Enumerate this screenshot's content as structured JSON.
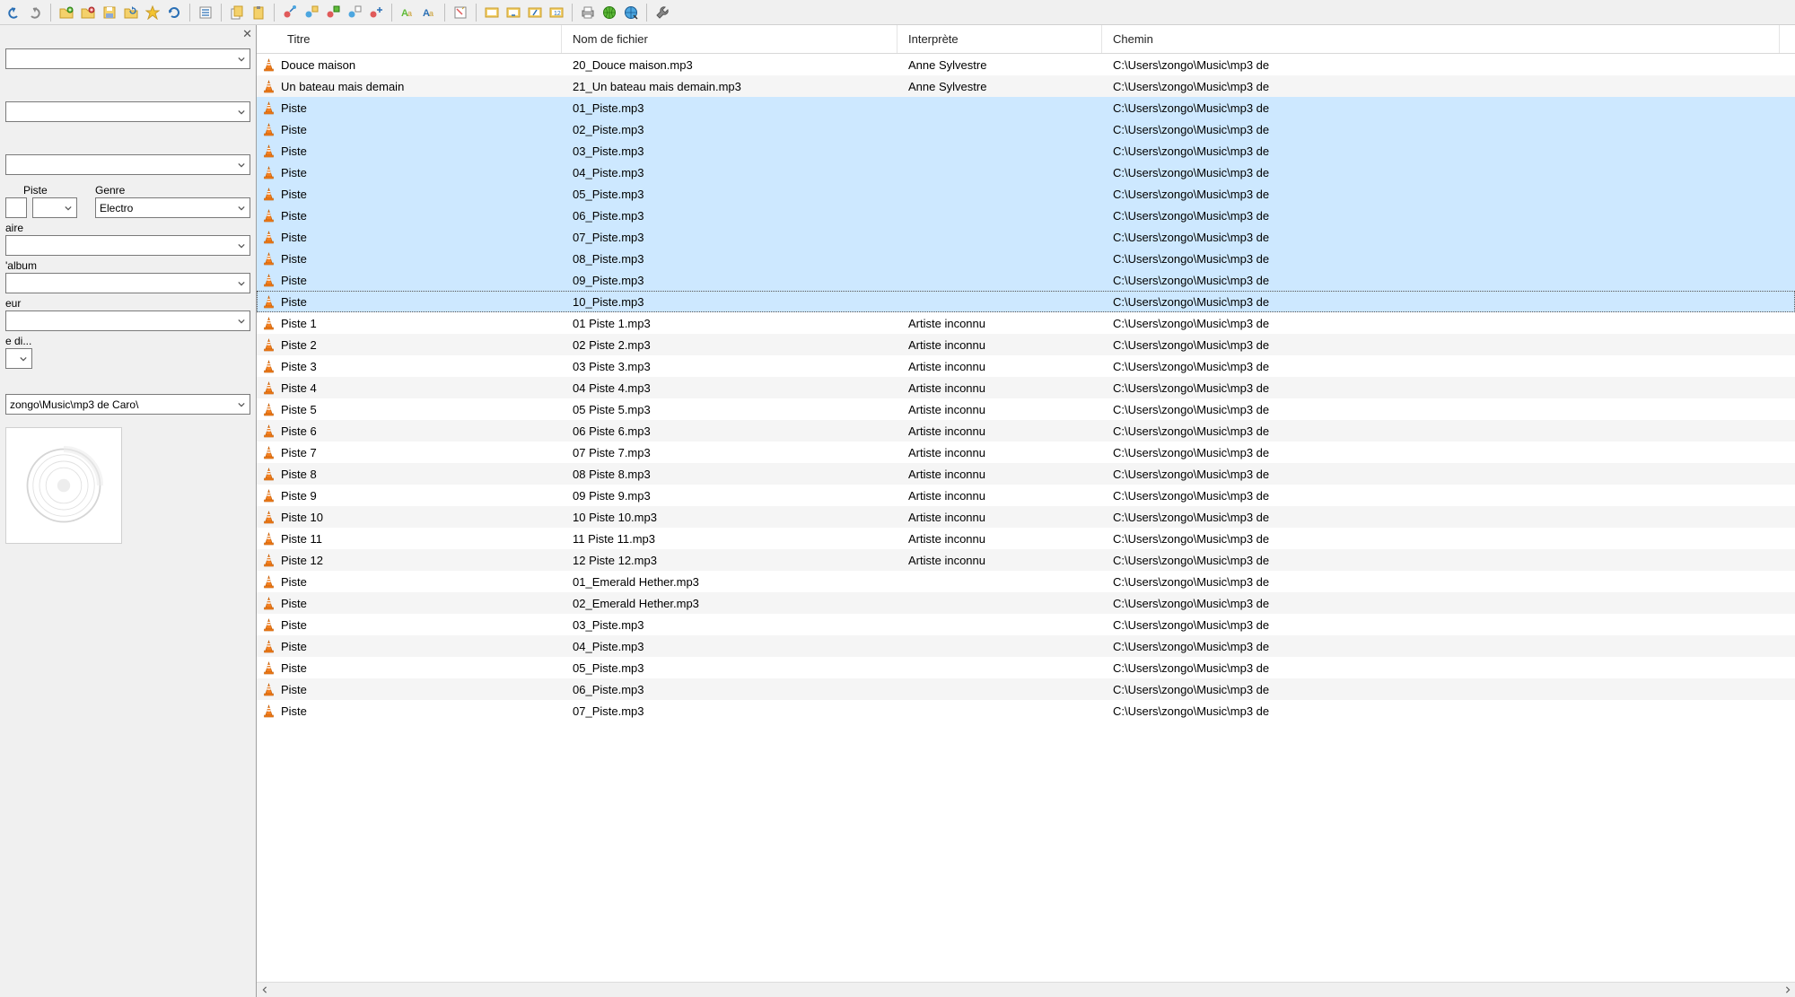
{
  "toolbar": {
    "icons": [
      "undo",
      "redo",
      "sep",
      "folder-open",
      "folder-add",
      "save",
      "folder-refresh",
      "favorite",
      "refresh",
      "sep",
      "list",
      "sep",
      "copy",
      "paste",
      "sep",
      "tag-red",
      "tag-blue",
      "tag-green",
      "tag-blue2",
      "tag-red2",
      "sep",
      "text-find",
      "text-edit",
      "sep",
      "note",
      "sep",
      "field-a",
      "field-b",
      "field-c",
      "field-num",
      "sep",
      "print",
      "globe",
      "globe2",
      "sep",
      "wrench"
    ]
  },
  "left_panel": {
    "labels": {
      "piste": "Piste",
      "genre": "Genre",
      "aire": "aire",
      "album": "'album",
      "eur": "eur",
      "e_di": "e di..."
    },
    "genre_value": "Electro",
    "path_value": "zongo\\Music\\mp3 de Caro\\"
  },
  "columns": {
    "titre": "Titre",
    "fichier": "Nom de fichier",
    "interprete": "Interprète",
    "chemin": "Chemin"
  },
  "chemin_value": "C:\\Users\\zongo\\Music\\mp3 de",
  "tracks": [
    {
      "titre": "Douce maison",
      "fichier": "20_Douce maison.mp3",
      "interprete": "Anne Sylvestre",
      "sel": false
    },
    {
      "titre": "Un bateau mais demain",
      "fichier": "21_Un bateau mais demain.mp3",
      "interprete": "Anne Sylvestre",
      "sel": false
    },
    {
      "titre": "Piste",
      "fichier": "01_Piste.mp3",
      "interprete": "",
      "sel": true
    },
    {
      "titre": "Piste",
      "fichier": "02_Piste.mp3",
      "interprete": "",
      "sel": true
    },
    {
      "titre": "Piste",
      "fichier": "03_Piste.mp3",
      "interprete": "",
      "sel": true
    },
    {
      "titre": "Piste",
      "fichier": "04_Piste.mp3",
      "interprete": "",
      "sel": true
    },
    {
      "titre": "Piste",
      "fichier": "05_Piste.mp3",
      "interprete": "",
      "sel": true
    },
    {
      "titre": "Piste",
      "fichier": "06_Piste.mp3",
      "interprete": "",
      "sel": true
    },
    {
      "titre": "Piste",
      "fichier": "07_Piste.mp3",
      "interprete": "",
      "sel": true
    },
    {
      "titre": "Piste",
      "fichier": "08_Piste.mp3",
      "interprete": "",
      "sel": true
    },
    {
      "titre": "Piste",
      "fichier": "09_Piste.mp3",
      "interprete": "",
      "sel": true
    },
    {
      "titre": "Piste",
      "fichier": "10_Piste.mp3",
      "interprete": "",
      "sel": true,
      "focus": true
    },
    {
      "titre": "Piste 1",
      "fichier": "01 Piste 1.mp3",
      "interprete": "Artiste inconnu",
      "sel": false
    },
    {
      "titre": "Piste 2",
      "fichier": "02 Piste 2.mp3",
      "interprete": "Artiste inconnu",
      "sel": false
    },
    {
      "titre": "Piste 3",
      "fichier": "03 Piste 3.mp3",
      "interprete": "Artiste inconnu",
      "sel": false
    },
    {
      "titre": "Piste 4",
      "fichier": "04 Piste 4.mp3",
      "interprete": "Artiste inconnu",
      "sel": false
    },
    {
      "titre": "Piste 5",
      "fichier": "05 Piste 5.mp3",
      "interprete": "Artiste inconnu",
      "sel": false
    },
    {
      "titre": "Piste 6",
      "fichier": "06 Piste 6.mp3",
      "interprete": "Artiste inconnu",
      "sel": false
    },
    {
      "titre": "Piste 7",
      "fichier": "07 Piste 7.mp3",
      "interprete": "Artiste inconnu",
      "sel": false
    },
    {
      "titre": "Piste 8",
      "fichier": "08 Piste 8.mp3",
      "interprete": "Artiste inconnu",
      "sel": false
    },
    {
      "titre": "Piste 9",
      "fichier": "09 Piste 9.mp3",
      "interprete": "Artiste inconnu",
      "sel": false
    },
    {
      "titre": "Piste 10",
      "fichier": "10 Piste 10.mp3",
      "interprete": "Artiste inconnu",
      "sel": false
    },
    {
      "titre": "Piste 11",
      "fichier": "11 Piste 11.mp3",
      "interprete": "Artiste inconnu",
      "sel": false
    },
    {
      "titre": "Piste 12",
      "fichier": "12 Piste 12.mp3",
      "interprete": "Artiste inconnu",
      "sel": false
    },
    {
      "titre": "Piste",
      "fichier": "01_Emerald Hether.mp3",
      "interprete": "",
      "sel": false
    },
    {
      "titre": "Piste",
      "fichier": "02_Emerald Hether.mp3",
      "interprete": "",
      "sel": false
    },
    {
      "titre": "Piste",
      "fichier": "03_Piste.mp3",
      "interprete": "",
      "sel": false
    },
    {
      "titre": "Piste",
      "fichier": "04_Piste.mp3",
      "interprete": "",
      "sel": false
    },
    {
      "titre": "Piste",
      "fichier": "05_Piste.mp3",
      "interprete": "",
      "sel": false
    },
    {
      "titre": "Piste",
      "fichier": "06_Piste.mp3",
      "interprete": "",
      "sel": false
    },
    {
      "titre": "Piste",
      "fichier": "07_Piste.mp3",
      "interprete": "",
      "sel": false
    }
  ]
}
